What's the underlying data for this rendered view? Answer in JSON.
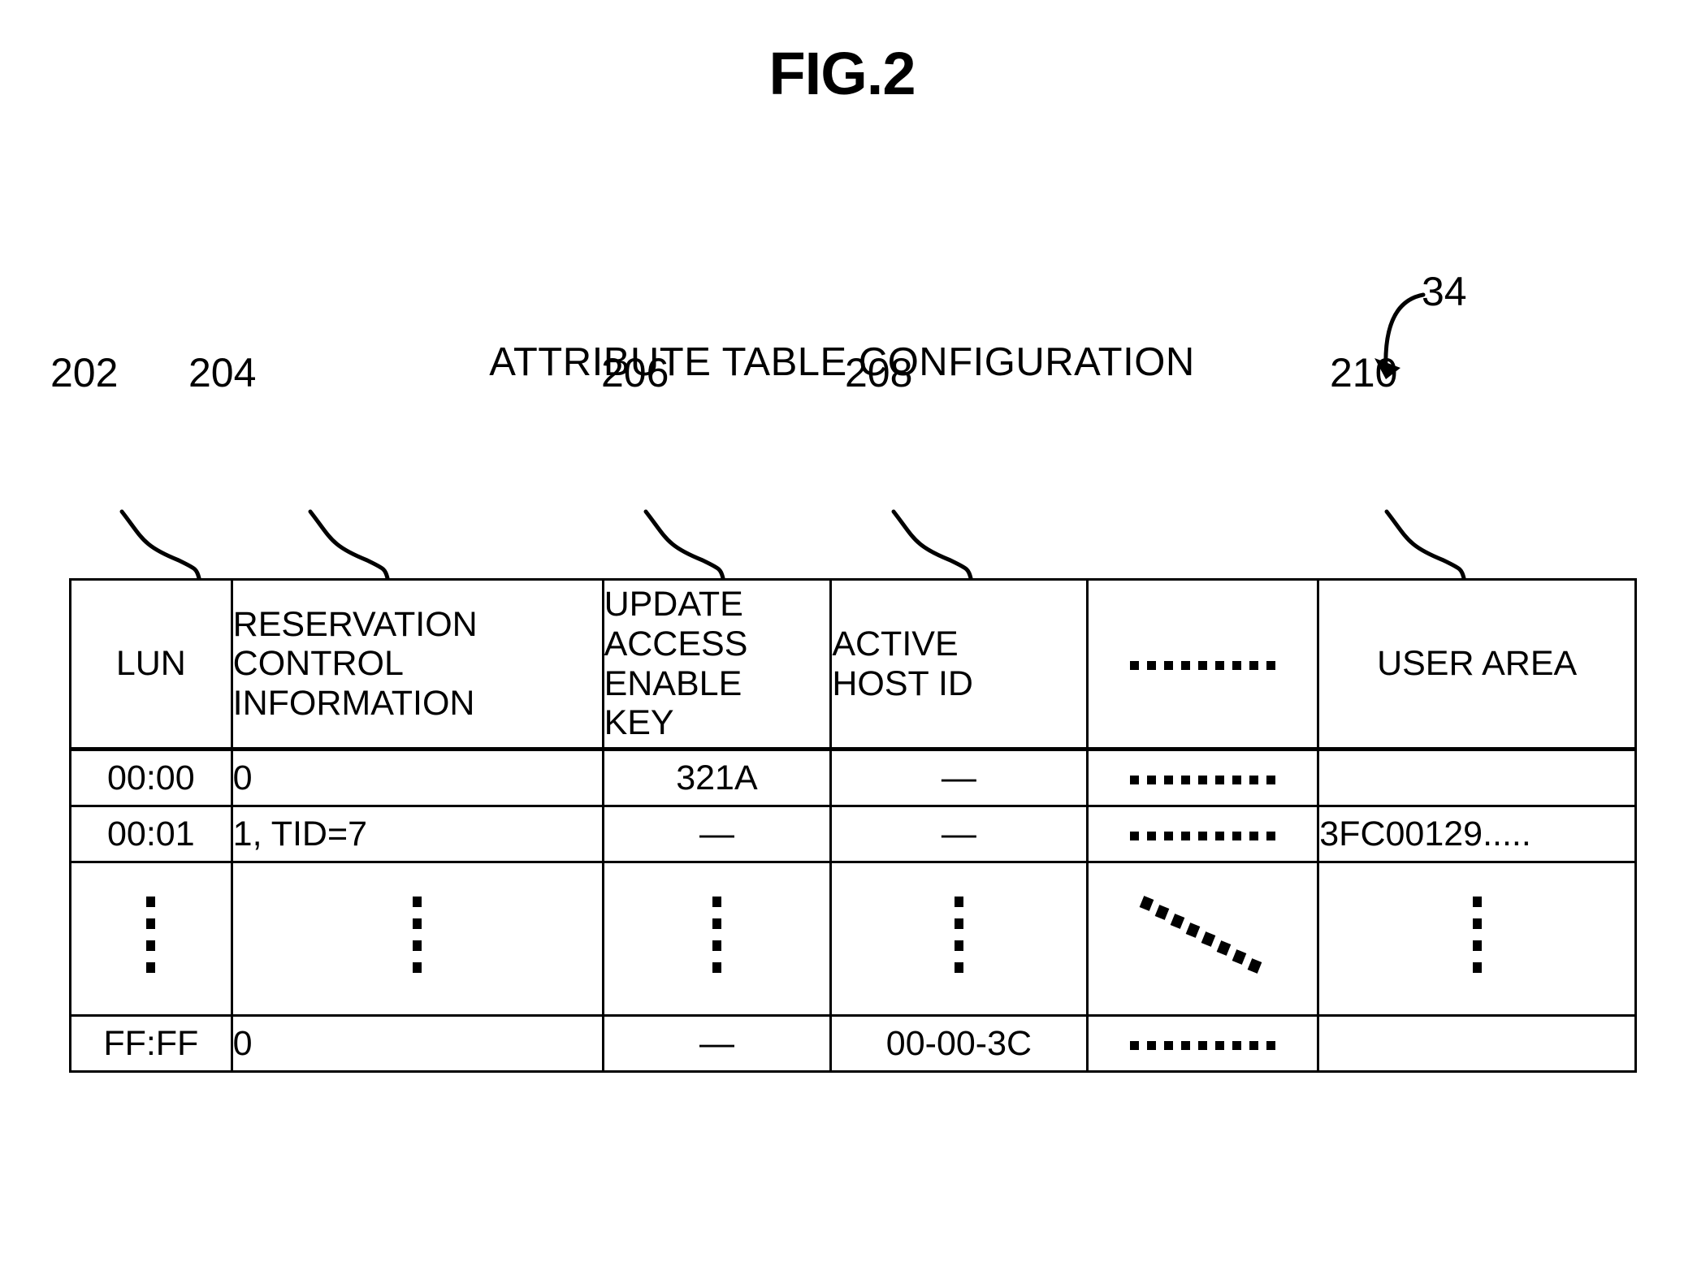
{
  "figure": {
    "title": "FIG.2",
    "subtitle": "ATTRIBUTE TABLE CONFIGURATION",
    "overall_ref": "34"
  },
  "column_refs": [
    {
      "label": "202",
      "target": "lun"
    },
    {
      "label": "204",
      "target": "reservation-control-information"
    },
    {
      "label": "206",
      "target": "update-access-enable-key"
    },
    {
      "label": "208",
      "target": "active-host-id"
    },
    {
      "label": "210",
      "target": "user-area"
    }
  ],
  "table": {
    "headers": [
      {
        "id": "lun",
        "lines": [
          "LUN"
        ],
        "align": "center"
      },
      {
        "id": "reservation-control-information",
        "lines": [
          "RESERVATION",
          "CONTROL",
          "INFORMATION"
        ],
        "align": "left"
      },
      {
        "id": "update-access-enable-key",
        "lines": [
          "UPDATE",
          "ACCESS",
          "ENABLE",
          "KEY"
        ],
        "align": "left"
      },
      {
        "id": "active-host-id",
        "lines": [
          "ACTIVE",
          "HOST ID"
        ],
        "align": "left"
      },
      {
        "id": "ellipsis-column",
        "lines": [
          "........."
        ],
        "align": "center"
      },
      {
        "id": "user-area",
        "lines": [
          "USER AREA"
        ],
        "align": "center"
      }
    ],
    "rows": [
      {
        "type": "data",
        "lun": "00:00",
        "reservation_control_information": "0",
        "update_access_enable_key": "321A",
        "active_host_id": "—",
        "ellipsis": ".........",
        "user_area": ""
      },
      {
        "type": "data",
        "lun": "00:01",
        "reservation_control_information": "1, TID=7",
        "update_access_enable_key": "—",
        "active_host_id": "—",
        "ellipsis": ".........",
        "user_area": "3FC00129....."
      },
      {
        "type": "ellipsis",
        "lun": "⋮",
        "reservation_control_information": "⋮",
        "update_access_enable_key": "⋮",
        "active_host_id": "⋮",
        "ellipsis": "diagonal-dots",
        "user_area": "⋮"
      },
      {
        "type": "data",
        "lun": "FF:FF",
        "reservation_control_information": "0",
        "update_access_enable_key": "—",
        "active_host_id": "00-00-3C",
        "ellipsis": ".........",
        "user_area": ""
      }
    ]
  },
  "colors": {
    "ink": "#000000",
    "paper": "#ffffff"
  }
}
